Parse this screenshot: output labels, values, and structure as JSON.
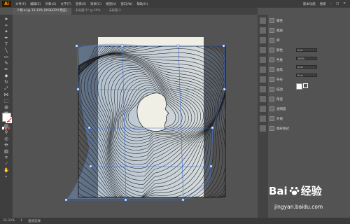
{
  "menubar": {
    "logo": "Ai",
    "items": [
      "文件(F)",
      "编辑(E)",
      "对象(O)",
      "文字(T)",
      "选择(S)",
      "效果(C)",
      "视图(V)",
      "窗口(W)",
      "帮助(H)"
    ],
    "workspace": "基本功能",
    "search_placeholder": "搜索"
  },
  "tabs": [
    {
      "label": "人物.ai @ 33.33% (RGB/GPU 预览)",
      "active": true
    },
    {
      "label": "未标题-1* @ 50%",
      "active": false
    },
    {
      "label": "未标题-2",
      "active": false
    }
  ],
  "toolbar": {
    "tools": [
      "selection-tool",
      "direct-selection-tool",
      "magic-wand-tool",
      "pen-tool",
      "type-tool",
      "line-tool",
      "rectangle-tool",
      "paintbrush-tool",
      "pencil-tool",
      "eraser-tool",
      "rotate-tool",
      "scale-tool",
      "width-tool",
      "free-transform-tool",
      "shape-builder-tool",
      "perspective-tool",
      "mesh-tool",
      "gradient-tool",
      "eyedropper-tool",
      "blend-tool",
      "symbol-sprayer-tool",
      "graph-tool",
      "artboard-tool",
      "slice-tool",
      "hand-tool",
      "zoom-tool"
    ],
    "fill_color": "#ffffff",
    "stroke_color": "#ff0000"
  },
  "panel": {
    "rows": [
      "属性",
      "图层",
      "库",
      "颜色",
      "色板",
      "画笔",
      "符号",
      "描边",
      "渐变",
      "透明度",
      "外观",
      "图形样式"
    ],
    "fields": [
      "0 pt",
      "100%",
      "0 px",
      "0 px"
    ]
  },
  "status": {
    "zoom": "33.33%",
    "page": "1",
    "tool_label": "直接选择"
  },
  "watermark": {
    "brand": "Bai",
    "brand_suffix": "经验",
    "url": "jingyan.baidu.com"
  },
  "colors": {
    "artboard": "#f0efe6",
    "selection": "#3d6fd4",
    "lines": "#1c1c1c"
  }
}
